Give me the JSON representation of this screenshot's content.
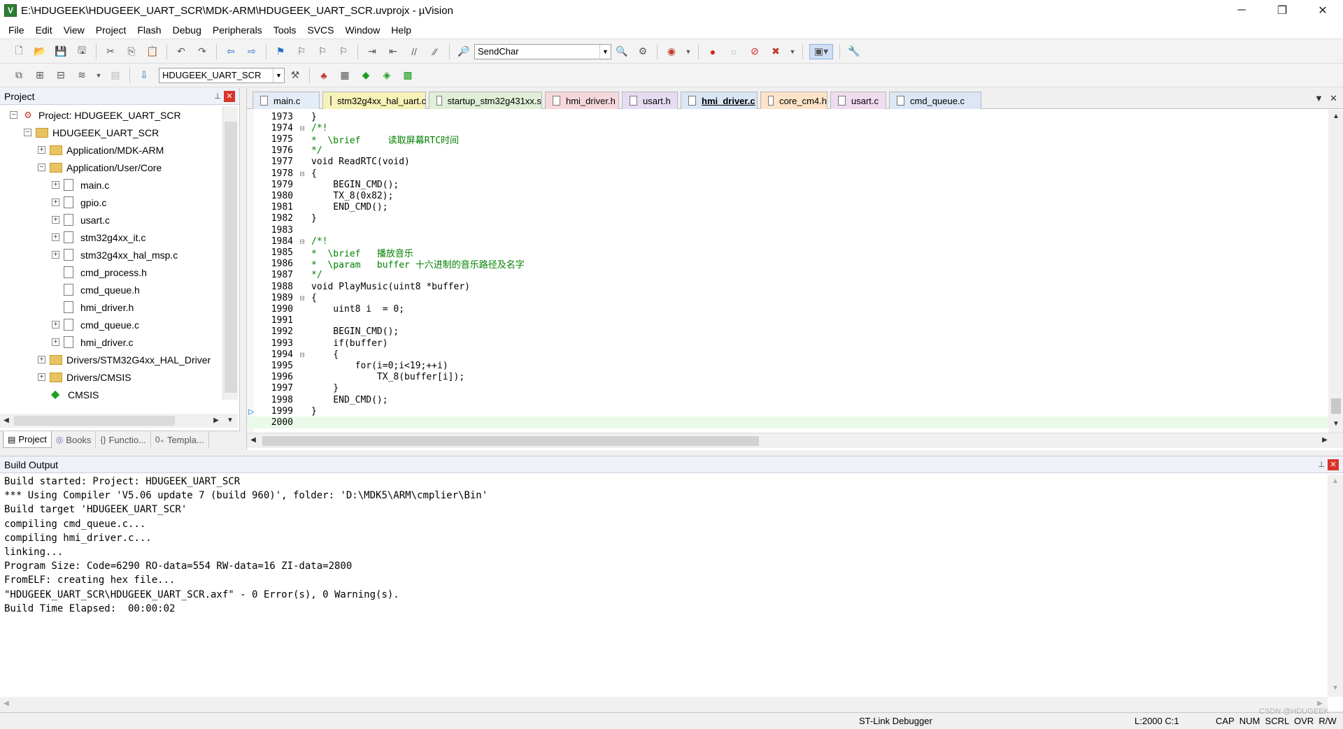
{
  "window": {
    "title": "E:\\HDUGEEK\\HDUGEEK_UART_SCR\\MDK-ARM\\HDUGEEK_UART_SCR.uvprojx - µVision"
  },
  "menu": [
    "File",
    "Edit",
    "View",
    "Project",
    "Flash",
    "Debug",
    "Peripherals",
    "Tools",
    "SVCS",
    "Window",
    "Help"
  ],
  "toolbar": {
    "find_combo_value": "SendChar",
    "target_combo_value": "HDUGEEK_UART_SCR"
  },
  "project_pane": {
    "title": "Project",
    "tree": [
      {
        "label": "Project: HDUGEEK_UART_SCR",
        "type": "project"
      },
      {
        "label": "HDUGEEK_UART_SCR",
        "type": "target"
      },
      {
        "label": "Application/MDK-ARM",
        "type": "folder"
      },
      {
        "label": "Application/User/Core",
        "type": "folder"
      },
      {
        "label": "main.c",
        "type": "file"
      },
      {
        "label": "gpio.c",
        "type": "file"
      },
      {
        "label": "usart.c",
        "type": "file"
      },
      {
        "label": "stm32g4xx_it.c",
        "type": "file"
      },
      {
        "label": "stm32g4xx_hal_msp.c",
        "type": "file"
      },
      {
        "label": "cmd_process.h",
        "type": "file"
      },
      {
        "label": "cmd_queue.h",
        "type": "file"
      },
      {
        "label": "hmi_driver.h",
        "type": "file"
      },
      {
        "label": "cmd_queue.c",
        "type": "file"
      },
      {
        "label": "hmi_driver.c",
        "type": "file"
      },
      {
        "label": "Drivers/STM32G4xx_HAL_Driver",
        "type": "folder"
      },
      {
        "label": "Drivers/CMSIS",
        "type": "folder"
      },
      {
        "label": "CMSIS",
        "type": "cmsis"
      }
    ],
    "tabs": [
      "Project",
      "Books",
      "Functio...",
      "Templa..."
    ]
  },
  "editor": {
    "tabs": [
      "main.c",
      "stm32g4xx_hal_uart.c",
      "startup_stm32g431xx.s",
      "hmi_driver.h",
      "usart.h",
      "hmi_driver.c",
      "core_cm4.h",
      "usart.c",
      "cmd_queue.c"
    ],
    "active_tab": "hmi_driver.c",
    "tab_colors": [
      "#e3ecf7",
      "#f7f2b8",
      "#e0efd8",
      "#f6d8dc",
      "#e6dcf2",
      "#dbe6f5",
      "#fde3c8",
      "#f0dcef",
      "#dce6f5"
    ],
    "lines": [
      {
        "n": "1973",
        "fold": "",
        "code": "}"
      },
      {
        "n": "1974",
        "fold": "⊟",
        "code": "/*!"
      },
      {
        "n": "1975",
        "fold": "",
        "code": "*  \\brief     读取屏幕RTC时间"
      },
      {
        "n": "1976",
        "fold": "",
        "code": "*/"
      },
      {
        "n": "1977",
        "fold": "",
        "code": "void ReadRTC(void)"
      },
      {
        "n": "1978",
        "fold": "⊟",
        "code": "{"
      },
      {
        "n": "1979",
        "fold": "",
        "code": "    BEGIN_CMD();"
      },
      {
        "n": "1980",
        "fold": "",
        "code": "    TX_8(0x82);"
      },
      {
        "n": "1981",
        "fold": "",
        "code": "    END_CMD();"
      },
      {
        "n": "1982",
        "fold": "",
        "code": "}"
      },
      {
        "n": "1983",
        "fold": "",
        "code": ""
      },
      {
        "n": "1984",
        "fold": "⊟",
        "code": "/*!"
      },
      {
        "n": "1985",
        "fold": "",
        "code": "*  \\brief   播放音乐"
      },
      {
        "n": "1986",
        "fold": "",
        "code": "*  \\param   buffer 十六进制的音乐路径及名字"
      },
      {
        "n": "1987",
        "fold": "",
        "code": "*/"
      },
      {
        "n": "1988",
        "fold": "",
        "code": "void PlayMusic(uint8 *buffer)"
      },
      {
        "n": "1989",
        "fold": "⊟",
        "code": "{"
      },
      {
        "n": "1990",
        "fold": "",
        "code": "    uint8 i  = 0;"
      },
      {
        "n": "1991",
        "fold": "",
        "code": ""
      },
      {
        "n": "1992",
        "fold": "",
        "code": "    BEGIN_CMD();"
      },
      {
        "n": "1993",
        "fold": "",
        "code": "    if(buffer)"
      },
      {
        "n": "1994",
        "fold": "⊟",
        "code": "    {"
      },
      {
        "n": "1995",
        "fold": "",
        "code": "        for(i=0;i<19;++i)"
      },
      {
        "n": "1996",
        "fold": "",
        "code": "            TX_8(buffer[i]);"
      },
      {
        "n": "1997",
        "fold": "",
        "code": "    }"
      },
      {
        "n": "1998",
        "fold": "",
        "code": "    END_CMD();"
      },
      {
        "n": "1999",
        "fold": "",
        "code": "}"
      },
      {
        "n": "2000",
        "fold": "",
        "code": ""
      }
    ]
  },
  "build_output": {
    "title": "Build Output",
    "lines": [
      "Build started: Project: HDUGEEK_UART_SCR",
      "*** Using Compiler 'V5.06 update 7 (build 960)', folder: 'D:\\MDK5\\ARM\\cmplier\\Bin'",
      "Build target 'HDUGEEK_UART_SCR'",
      "compiling cmd_queue.c...",
      "compiling hmi_driver.c...",
      "linking...",
      "Program Size: Code=6290 RO-data=554 RW-data=16 ZI-data=2800",
      "FromELF: creating hex file...",
      "\"HDUGEEK_UART_SCR\\HDUGEEK_UART_SCR.axf\" - 0 Error(s), 0 Warning(s).",
      "Build Time Elapsed:  00:00:02"
    ]
  },
  "status": {
    "debugger": "ST-Link Debugger",
    "position": "L:2000 C:1",
    "indicators": "CAP  NUM  SCRL  OVR  R/W",
    "watermark": "CSDN @HDUGEEK"
  },
  "icons": {
    "minimize": "─",
    "restore": "❐",
    "close": "✕",
    "pin": "📌",
    "dropdown": "▼"
  }
}
